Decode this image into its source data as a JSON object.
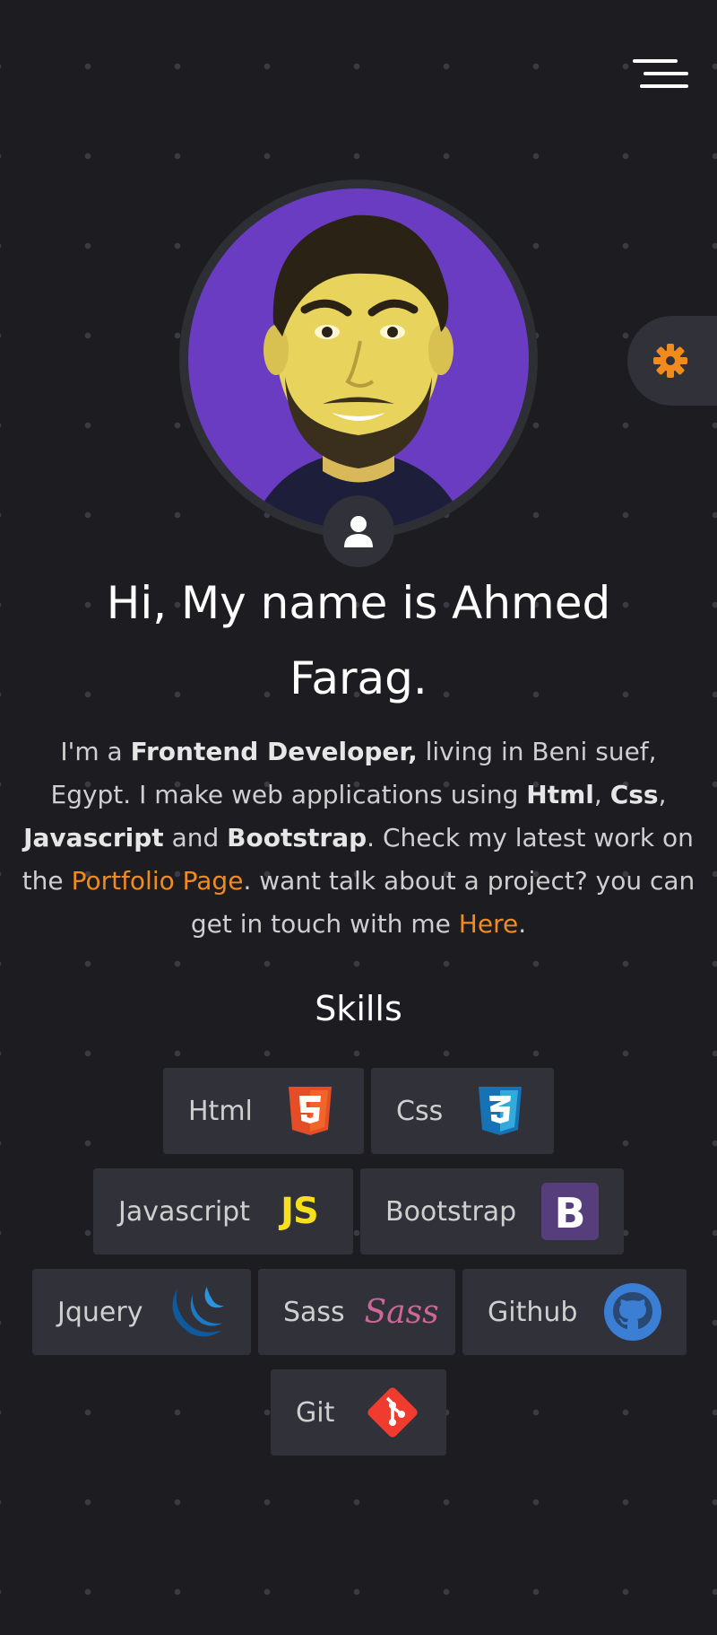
{
  "header": {
    "menu_icon": "hamburger-menu-icon"
  },
  "settings": {
    "icon": "gear-icon",
    "accent": "#f28b1d"
  },
  "profile": {
    "badge_icon": "user-icon",
    "photo_bg": "#6a3cc1"
  },
  "hero": {
    "title": "Hi, My name is Ahmed Farag.",
    "intro": {
      "t1": "I'm a ",
      "role": "Frontend Developer,",
      "t2": " living in Beni suef, Egypt. I make web applications using ",
      "s1": "Html",
      "sep1": ", ",
      "s2": "Css",
      "sep2": ", ",
      "s3": "Javascript",
      "t3": " and ",
      "s4": "Bootstrap",
      "t4": ". Check my latest work on the ",
      "portfolio_link": "Portfolio Page",
      "t5": ". want talk about a project? you can get in touch with me ",
      "contact_link": "Here",
      "t6": "."
    }
  },
  "skills": {
    "title": "Skills",
    "items": [
      {
        "label": "Html",
        "icon": "html5-icon"
      },
      {
        "label": "Css",
        "icon": "css3-icon"
      },
      {
        "label": "Javascript",
        "icon": "javascript-icon"
      },
      {
        "label": "Bootstrap",
        "icon": "bootstrap-icon"
      },
      {
        "label": "Jquery",
        "icon": "jquery-icon"
      },
      {
        "label": "Sass",
        "icon": "sass-icon"
      },
      {
        "label": "Github",
        "icon": "github-icon"
      },
      {
        "label": "Git",
        "icon": "git-icon"
      }
    ]
  },
  "colors": {
    "background": "#1c1c21",
    "card": "#31313a",
    "accent": "#f28b1d",
    "text": "#d7d7d7"
  }
}
